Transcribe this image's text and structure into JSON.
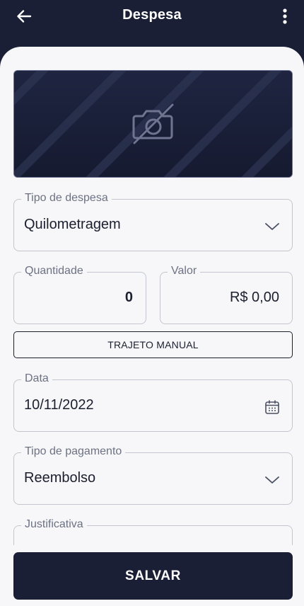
{
  "appbar": {
    "title": "Despesa",
    "back_icon": "arrow-left-icon",
    "menu_icon": "more-vertical-icon"
  },
  "photo": {
    "icon": "camera-off-icon"
  },
  "form": {
    "tipo_despesa": {
      "label": "Tipo de despesa",
      "value": "Quilometragem",
      "icon": "chevron-down-icon"
    },
    "quantidade": {
      "label": "Quantidade",
      "value": "0"
    },
    "valor": {
      "label": "Valor",
      "value": "R$ 0,00"
    },
    "trajeto_button": "TRAJETO MANUAL",
    "data": {
      "label": "Data",
      "value": "10/11/2022",
      "icon": "calendar-icon"
    },
    "tipo_pagamento": {
      "label": "Tipo de pagamento",
      "value": "Reembolso",
      "icon": "chevron-down-icon"
    },
    "justificativa": {
      "label": "Justificativa",
      "value": ""
    }
  },
  "actions": {
    "save_label": "SALVAR"
  },
  "colors": {
    "primary": "#1a1f36",
    "background": "#f7f7f9",
    "border": "#c3c6ce",
    "label": "#6c7283"
  }
}
